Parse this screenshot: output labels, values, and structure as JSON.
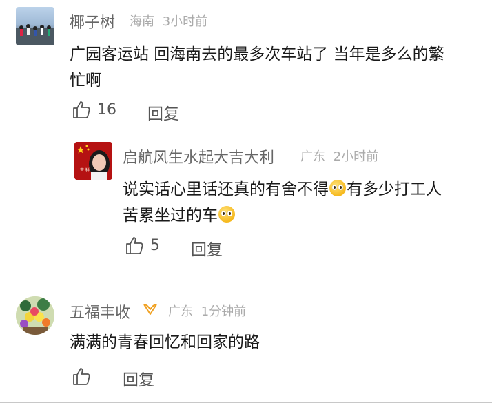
{
  "comments": [
    {
      "user": "椰子树",
      "location": "海南",
      "time": "3小时前",
      "text_line1": "广园客运站 回海南去的最多次车站了 当年是多么的繁",
      "text_line2": "忙啊",
      "likes": "16",
      "reply_label": "回复",
      "avatar_icon": "crowd-street-photo-icon"
    },
    {
      "user": "启航风生水起大吉大利",
      "location": "广东",
      "time": "2小时前",
      "text_part1": "说实话心里话还真的有舍不得",
      "text_part2": "有多少打工人",
      "text_line2": "苦累坐过的车",
      "likes": "5",
      "reply_label": "回复",
      "avatar_icon": "woman-portrait-flag-icon",
      "emoji_icon": "pleading-face-emoji-icon"
    },
    {
      "user": "五福丰收",
      "location": "广东",
      "time": "1分钟前",
      "text_line1": "满满的青春回忆和回家的路",
      "likes": "",
      "reply_label": "回复",
      "avatar_icon": "flower-bouquet-photo-icon",
      "badge_icon": "gold-badge-icon"
    }
  ],
  "colors": {
    "username": "#666666",
    "meta": "#aaaaaa",
    "body": "#1a1a1a",
    "action": "#555555",
    "badge": "#f0a020"
  }
}
